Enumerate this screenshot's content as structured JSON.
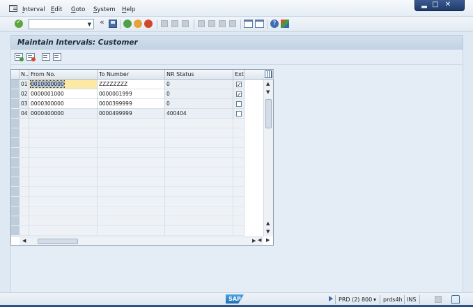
{
  "menu": [
    {
      "label": "Interval",
      "underline": "I",
      "rest": "nterval"
    },
    {
      "label": "Edit",
      "underline": "E",
      "rest": "dit"
    },
    {
      "label": "Goto",
      "underline": "G",
      "rest": "oto"
    },
    {
      "label": "System",
      "underline": "S",
      "rest": "ystem"
    },
    {
      "label": "Help",
      "underline": "H",
      "rest": "elp"
    }
  ],
  "window_controls": {
    "minimize": "▂",
    "maximize": "□",
    "close": "✕"
  },
  "toolbar": {
    "command_field_value": "",
    "dropdown_arrow": "▼",
    "history": "«"
  },
  "page_title": "Maintain Intervals: Customer",
  "table": {
    "headers": [
      "N..",
      "From No.",
      "To Number",
      "NR Status",
      "Ext"
    ],
    "rows": [
      {
        "no": "01",
        "from": "0010000000",
        "to": "ZZZZZZZZ",
        "status": "0",
        "ext": true
      },
      {
        "no": "02",
        "from": "0000001000",
        "to": "0000001999",
        "status": "0",
        "ext": true
      },
      {
        "no": "03",
        "from": "0000300000",
        "to": "0000399999",
        "status": "0",
        "ext": false
      },
      {
        "no": "04",
        "from": "0000400000",
        "to": "0000499999",
        "status": "400404",
        "ext": false
      }
    ]
  },
  "scroll": {
    "up": "▲",
    "down": "▼",
    "left": "◀",
    "right": "▶"
  },
  "status": {
    "logo": "SAP",
    "system": "PRD (2) 800",
    "dropdown": "▾",
    "server": "prds4h",
    "mode": "INS"
  },
  "colors": {
    "accent": "#2f5286",
    "focus": "#fde9a6"
  }
}
